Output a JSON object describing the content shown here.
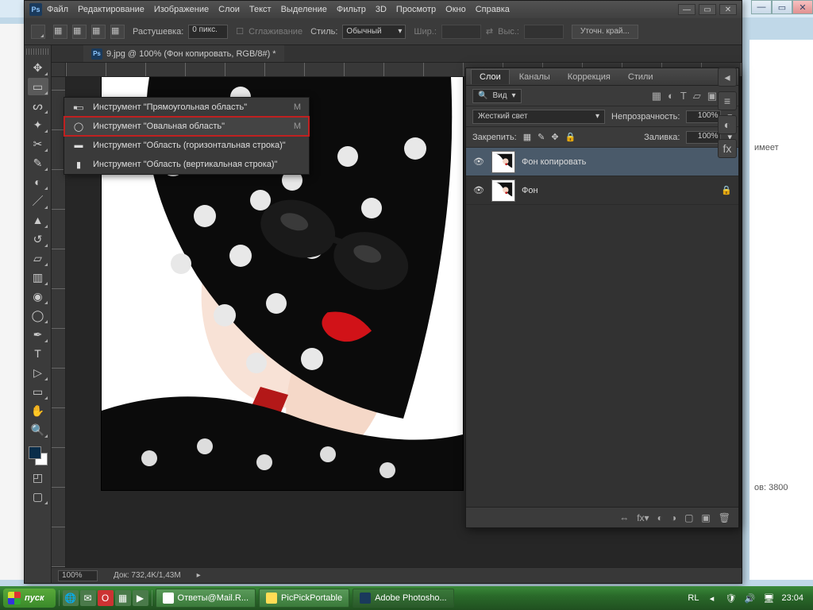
{
  "menu": [
    "Файл",
    "Редактирование",
    "Изображение",
    "Слои",
    "Текст",
    "Выделение",
    "Фильтр",
    "3D",
    "Просмотр",
    "Окно",
    "Справка"
  ],
  "options": {
    "feather_label": "Растушевка:",
    "feather_value": "0 пикс.",
    "antialias_label": "Сглаживание",
    "style_label": "Стиль:",
    "style_value": "Обычный",
    "width_label": "Шир.:",
    "height_label": "Выс.:",
    "refine_label": "Уточн. край..."
  },
  "doc_tab": "9.jpg @ 100% (Фон копировать, RGB/8#) *",
  "flyout": [
    {
      "label": "Инструмент \"Прямоугольная область\"",
      "key": "M"
    },
    {
      "label": "Инструмент \"Овальная область\"",
      "key": "M"
    },
    {
      "label": "Инструмент \"Область (горизонтальная строка)\"",
      "key": ""
    },
    {
      "label": "Инструмент \"Область (вертикальная строка)\"",
      "key": ""
    }
  ],
  "panel": {
    "tabs": [
      "Слои",
      "Каналы",
      "Коррекция",
      "Стили"
    ],
    "filter_label": "Вид",
    "blend_value": "Жесткий свет",
    "opacity_label": "Непрозрачность:",
    "opacity_value": "100%",
    "lock_label": "Закрепить:",
    "fill_label": "Заливка:",
    "fill_value": "100%",
    "layers": [
      {
        "name": "Фон копировать",
        "locked": false
      },
      {
        "name": "Фон",
        "locked": true
      }
    ]
  },
  "status": {
    "zoom": "100%",
    "doc": "Док: 732,4K/1,43M"
  },
  "taskbar": {
    "start": "пуск",
    "items": [
      "Ответы@Mail.R...",
      "PicPickPortable",
      "Adobe Photosho..."
    ],
    "lang": "RL",
    "time": "23:04"
  },
  "browser": {
    "txt1": "имеет",
    "txt2": "ов: 3800"
  }
}
